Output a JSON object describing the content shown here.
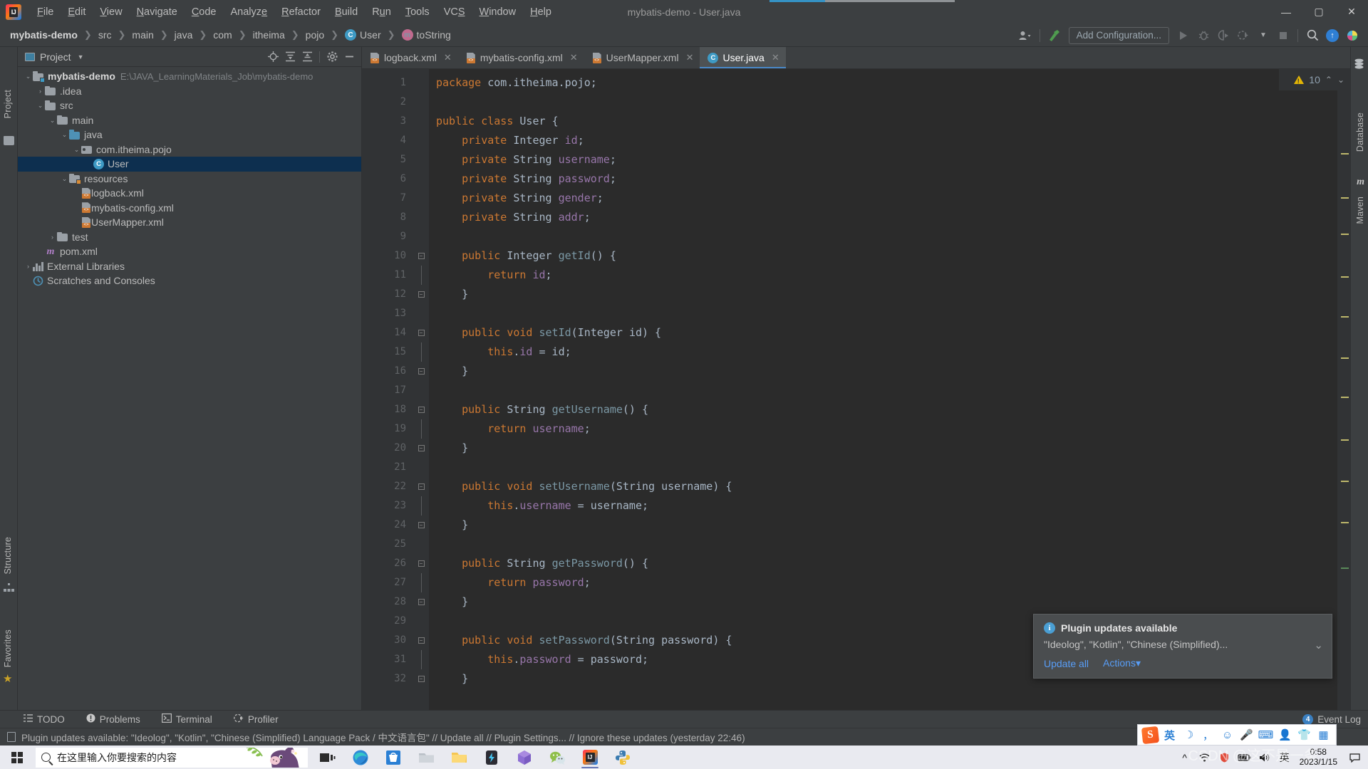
{
  "window": {
    "title": "mybatis-demo - User.java",
    "minimize": "—",
    "maximize": "▢",
    "close": "✕"
  },
  "menu": {
    "items": [
      {
        "label": "File"
      },
      {
        "label": "Edit"
      },
      {
        "label": "View"
      },
      {
        "label": "Navigate"
      },
      {
        "label": "Code"
      },
      {
        "label": "Analyze"
      },
      {
        "label": "Refactor"
      },
      {
        "label": "Build"
      },
      {
        "label": "Run"
      },
      {
        "label": "Tools"
      },
      {
        "label": "VCS"
      },
      {
        "label": "Window"
      },
      {
        "label": "Help"
      }
    ]
  },
  "breadcrumb": {
    "items": [
      {
        "label": "mybatis-demo",
        "icon": ""
      },
      {
        "label": "src",
        "icon": ""
      },
      {
        "label": "main",
        "icon": ""
      },
      {
        "label": "java",
        "icon": ""
      },
      {
        "label": "com",
        "icon": ""
      },
      {
        "label": "itheima",
        "icon": ""
      },
      {
        "label": "pojo",
        "icon": ""
      },
      {
        "label": "User",
        "icon": "class-icon"
      },
      {
        "label": "toString",
        "icon": "method-icon"
      }
    ],
    "separator": "❯"
  },
  "toolbar": {
    "add_configuration": "Add Configuration...",
    "icons": [
      "user-account-icon",
      "build-hammer-icon",
      "run-icon",
      "debug-icon",
      "run-coverage-icon",
      "profile-icon",
      "stop-icon",
      "search-everywhere-icon",
      "update-project-icon",
      "idea-assistant-icon"
    ]
  },
  "left_rail": {
    "project": "Project",
    "structure": "Structure",
    "favorites": "Favorites"
  },
  "right_rail": {
    "database": "Database",
    "maven": "Maven"
  },
  "project_panel": {
    "title": "Project",
    "actions": [
      "locate-icon",
      "expand-all-icon",
      "collapse-all-icon",
      "settings-gear-icon",
      "hide-icon"
    ],
    "tree": [
      {
        "label": "mybatis-demo",
        "path": "E:\\JAVA_LearningMaterials_Job\\mybatis-demo",
        "indent": 0,
        "arrow": "v",
        "icon": "module-folder",
        "bold": true,
        "selected": false
      },
      {
        "label": ".idea",
        "path": "",
        "indent": 1,
        "arrow": ">",
        "icon": "folder",
        "bold": false,
        "selected": false
      },
      {
        "label": "src",
        "path": "",
        "indent": 1,
        "arrow": "v",
        "icon": "folder",
        "bold": false,
        "selected": false
      },
      {
        "label": "main",
        "path": "",
        "indent": 2,
        "arrow": "v",
        "icon": "folder",
        "bold": false,
        "selected": false
      },
      {
        "label": "java",
        "path": "",
        "indent": 3,
        "arrow": "v",
        "icon": "source-folder",
        "bold": false,
        "selected": false
      },
      {
        "label": "com.itheima.pojo",
        "path": "",
        "indent": 4,
        "arrow": "v",
        "icon": "package",
        "bold": false,
        "selected": false
      },
      {
        "label": "User",
        "path": "",
        "indent": 5,
        "arrow": "",
        "icon": "java-class",
        "bold": false,
        "selected": true
      },
      {
        "label": "resources",
        "path": "",
        "indent": 3,
        "arrow": "v",
        "icon": "resource-folder",
        "bold": false,
        "selected": false
      },
      {
        "label": "logback.xml",
        "path": "",
        "indent": 4,
        "arrow": "",
        "icon": "xml-file",
        "bold": false,
        "selected": false
      },
      {
        "label": "mybatis-config.xml",
        "path": "",
        "indent": 4,
        "arrow": "",
        "icon": "xml-file",
        "bold": false,
        "selected": false
      },
      {
        "label": "UserMapper.xml",
        "path": "",
        "indent": 4,
        "arrow": "",
        "icon": "xml-file",
        "bold": false,
        "selected": false
      },
      {
        "label": "test",
        "path": "",
        "indent": 2,
        "arrow": ">",
        "icon": "folder",
        "bold": false,
        "selected": false
      },
      {
        "label": "pom.xml",
        "path": "",
        "indent": 1,
        "arrow": "",
        "icon": "maven-file",
        "bold": false,
        "selected": false
      },
      {
        "label": "External Libraries",
        "path": "",
        "indent": 0,
        "arrow": ">",
        "icon": "libraries",
        "bold": false,
        "selected": false
      },
      {
        "label": "Scratches and Consoles",
        "path": "",
        "indent": 0,
        "arrow": "",
        "icon": "scratches",
        "bold": false,
        "selected": false
      }
    ]
  },
  "editor": {
    "tabs": [
      {
        "label": "logback.xml",
        "icon": "xml-file",
        "active": false,
        "close": "✕"
      },
      {
        "label": "mybatis-config.xml",
        "icon": "xml-file",
        "active": false,
        "close": "✕"
      },
      {
        "label": "UserMapper.xml",
        "icon": "xml-file",
        "active": false,
        "close": "✕"
      },
      {
        "label": "User.java",
        "icon": "java-class",
        "active": true,
        "close": "✕"
      }
    ],
    "warning_count": "10",
    "warning_up": "⌃",
    "warning_down": "⌄",
    "first_line": 1,
    "lines": [
      {
        "n": 1,
        "fold": "",
        "tokens": [
          [
            "kw",
            "package"
          ],
          [
            "pln",
            " com.itheima.pojo;"
          ]
        ]
      },
      {
        "n": 2,
        "fold": "",
        "tokens": []
      },
      {
        "n": 3,
        "fold": "",
        "tokens": [
          [
            "kw",
            "public "
          ],
          [
            "kw",
            "class "
          ],
          [
            "typ",
            "User "
          ],
          [
            "pln",
            "{"
          ]
        ]
      },
      {
        "n": 4,
        "fold": "",
        "tokens": [
          [
            "pln",
            "    "
          ],
          [
            "kw",
            "private "
          ],
          [
            "typ",
            "Integer "
          ],
          [
            "fld",
            "id"
          ],
          [
            "pln",
            ";"
          ]
        ]
      },
      {
        "n": 5,
        "fold": "",
        "tokens": [
          [
            "pln",
            "    "
          ],
          [
            "kw",
            "private "
          ],
          [
            "typ",
            "String "
          ],
          [
            "fld",
            "username"
          ],
          [
            "pln",
            ";"
          ]
        ]
      },
      {
        "n": 6,
        "fold": "",
        "tokens": [
          [
            "pln",
            "    "
          ],
          [
            "kw",
            "private "
          ],
          [
            "typ",
            "String "
          ],
          [
            "fld",
            "password"
          ],
          [
            "pln",
            ";"
          ]
        ]
      },
      {
        "n": 7,
        "fold": "",
        "tokens": [
          [
            "pln",
            "    "
          ],
          [
            "kw",
            "private "
          ],
          [
            "typ",
            "String "
          ],
          [
            "fld",
            "gender"
          ],
          [
            "pln",
            ";"
          ]
        ]
      },
      {
        "n": 8,
        "fold": "",
        "tokens": [
          [
            "pln",
            "    "
          ],
          [
            "kw",
            "private "
          ],
          [
            "typ",
            "String "
          ],
          [
            "fld",
            "addr"
          ],
          [
            "pln",
            ";"
          ]
        ]
      },
      {
        "n": 9,
        "fold": "",
        "tokens": []
      },
      {
        "n": 10,
        "fold": "open",
        "tokens": [
          [
            "pln",
            "    "
          ],
          [
            "kw",
            "public "
          ],
          [
            "typ",
            "Integer "
          ],
          [
            "mth",
            "getId"
          ],
          [
            "pln",
            "() {"
          ]
        ]
      },
      {
        "n": 11,
        "fold": "bar",
        "tokens": [
          [
            "pln",
            "        "
          ],
          [
            "kw",
            "return "
          ],
          [
            "fld",
            "id"
          ],
          [
            "pln",
            ";"
          ]
        ]
      },
      {
        "n": 12,
        "fold": "close",
        "tokens": [
          [
            "pln",
            "    }"
          ]
        ]
      },
      {
        "n": 13,
        "fold": "",
        "tokens": []
      },
      {
        "n": 14,
        "fold": "open",
        "tokens": [
          [
            "pln",
            "    "
          ],
          [
            "kw",
            "public "
          ],
          [
            "kw",
            "void "
          ],
          [
            "mth",
            "setId"
          ],
          [
            "pln",
            "("
          ],
          [
            "typ",
            "Integer "
          ],
          [
            "pln",
            "id) {"
          ]
        ]
      },
      {
        "n": 15,
        "fold": "bar",
        "tokens": [
          [
            "pln",
            "        "
          ],
          [
            "kw",
            "this"
          ],
          [
            "pln",
            "."
          ],
          [
            "fld",
            "id"
          ],
          [
            "pln",
            " = id;"
          ]
        ]
      },
      {
        "n": 16,
        "fold": "close",
        "tokens": [
          [
            "pln",
            "    }"
          ]
        ]
      },
      {
        "n": 17,
        "fold": "",
        "tokens": []
      },
      {
        "n": 18,
        "fold": "open",
        "tokens": [
          [
            "pln",
            "    "
          ],
          [
            "kw",
            "public "
          ],
          [
            "typ",
            "String "
          ],
          [
            "mth",
            "getUsername"
          ],
          [
            "pln",
            "() {"
          ]
        ]
      },
      {
        "n": 19,
        "fold": "bar",
        "tokens": [
          [
            "pln",
            "        "
          ],
          [
            "kw",
            "return "
          ],
          [
            "fld",
            "username"
          ],
          [
            "pln",
            ";"
          ]
        ]
      },
      {
        "n": 20,
        "fold": "close",
        "tokens": [
          [
            "pln",
            "    }"
          ]
        ]
      },
      {
        "n": 21,
        "fold": "",
        "tokens": []
      },
      {
        "n": 22,
        "fold": "open",
        "tokens": [
          [
            "pln",
            "    "
          ],
          [
            "kw",
            "public "
          ],
          [
            "kw",
            "void "
          ],
          [
            "mth",
            "setUsername"
          ],
          [
            "pln",
            "("
          ],
          [
            "typ",
            "String "
          ],
          [
            "pln",
            "username) {"
          ]
        ]
      },
      {
        "n": 23,
        "fold": "bar",
        "tokens": [
          [
            "pln",
            "        "
          ],
          [
            "kw",
            "this"
          ],
          [
            "pln",
            "."
          ],
          [
            "fld",
            "username"
          ],
          [
            "pln",
            " = username;"
          ]
        ]
      },
      {
        "n": 24,
        "fold": "close",
        "tokens": [
          [
            "pln",
            "    }"
          ]
        ]
      },
      {
        "n": 25,
        "fold": "",
        "tokens": []
      },
      {
        "n": 26,
        "fold": "open",
        "tokens": [
          [
            "pln",
            "    "
          ],
          [
            "kw",
            "public "
          ],
          [
            "typ",
            "String "
          ],
          [
            "mth",
            "getPassword"
          ],
          [
            "pln",
            "() {"
          ]
        ]
      },
      {
        "n": 27,
        "fold": "bar",
        "tokens": [
          [
            "pln",
            "        "
          ],
          [
            "kw",
            "return "
          ],
          [
            "fld",
            "password"
          ],
          [
            "pln",
            ";"
          ]
        ]
      },
      {
        "n": 28,
        "fold": "close",
        "tokens": [
          [
            "pln",
            "    }"
          ]
        ]
      },
      {
        "n": 29,
        "fold": "",
        "tokens": []
      },
      {
        "n": 30,
        "fold": "open",
        "tokens": [
          [
            "pln",
            "    "
          ],
          [
            "kw",
            "public "
          ],
          [
            "kw",
            "void "
          ],
          [
            "mth",
            "setPassword"
          ],
          [
            "pln",
            "("
          ],
          [
            "typ",
            "String "
          ],
          [
            "pln",
            "password) {"
          ]
        ]
      },
      {
        "n": 31,
        "fold": "bar",
        "tokens": [
          [
            "pln",
            "        "
          ],
          [
            "kw",
            "this"
          ],
          [
            "pln",
            "."
          ],
          [
            "fld",
            "password"
          ],
          [
            "pln",
            " = password;"
          ]
        ]
      },
      {
        "n": 32,
        "fold": "close",
        "tokens": [
          [
            "pln",
            "    }"
          ]
        ]
      }
    ]
  },
  "notification": {
    "title": "Plugin updates available",
    "body": "\"Ideolog\", \"Kotlin\", \"Chinese (Simplified)...",
    "update_all": "Update all",
    "actions": "Actions",
    "actions_caret": "▾",
    "collapse": "⌄"
  },
  "bottom_bar": {
    "items": [
      {
        "label": "TODO",
        "icon": "todo-icon"
      },
      {
        "label": "Problems",
        "icon": "problems-icon"
      },
      {
        "label": "Terminal",
        "icon": "terminal-icon"
      },
      {
        "label": "Profiler",
        "icon": "profiler-icon"
      }
    ],
    "event_log": "Event Log",
    "event_count": "4"
  },
  "status_bar": {
    "message": "Plugin updates available: \"Ideolog\", \"Kotlin\", \"Chinese (Simplified) Language Pack / 中文语言包\" // Update all // Plugin Settings... // Ignore these updates (yesterday 22:46)"
  },
  "taskbar": {
    "search_placeholder": "在这里输入你要搜索的内容",
    "clock_time": "0:58",
    "clock_date": "2023/1/15",
    "ime_lang": "英",
    "watermark": "CSDN @这不是一条",
    "icons": [
      "task-view-icon",
      "edge-icon",
      "store-icon",
      "folder-icon",
      "explorer-icon",
      "flash-icon",
      "package-icon",
      "wechat-icon",
      "intellij-icon",
      "python-icon"
    ],
    "tray_icons": [
      "show-hidden-icon",
      "wifi-icon",
      "shield-icon",
      "power-icon",
      "volume-icon"
    ]
  },
  "colors": {
    "accent": "#3592c4",
    "editor_bg": "#2b2b2b",
    "panel_bg": "#3c3f41",
    "keyword": "#cc7832",
    "field": "#9876aa",
    "method": "#7b98a5",
    "plain": "#a9b7c6",
    "selection": "#0d2f4f"
  }
}
